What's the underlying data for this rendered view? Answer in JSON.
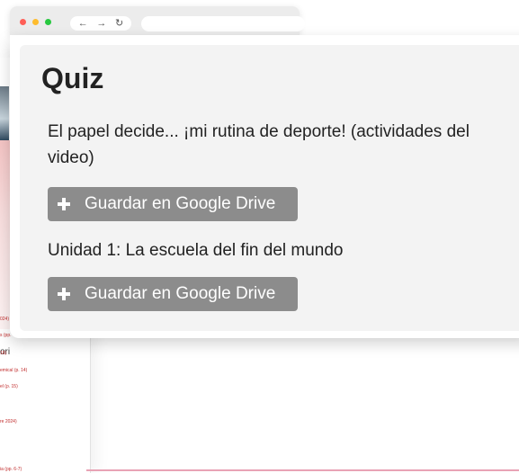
{
  "quiz": {
    "title": "Quiz",
    "items": [
      {
        "text": "El papel decide... ¡mi rutina de deporte! (actividades del video)",
        "button_label": "Guardar en Google Drive"
      },
      {
        "text": "Unidad 1: La escuela del fin del mundo",
        "button_label": "Guardar en Google Drive"
      }
    ]
  },
  "browser": {
    "traffic_light_colors": [
      "#ff5f57",
      "#febc2e",
      "#28c840"
    ],
    "nav_icons": [
      "back-arrow-icon",
      "forward-arrow-icon",
      "reload-icon"
    ]
  },
  "background_page": {
    "heading_fragment": "ori",
    "link_fragments": [
      "024)",
      "s (pp.",
      "16)",
      "emical (p. 14)",
      "el (p. 15)",
      "re 2024)",
      "ia (pp. 6-7)"
    ]
  }
}
